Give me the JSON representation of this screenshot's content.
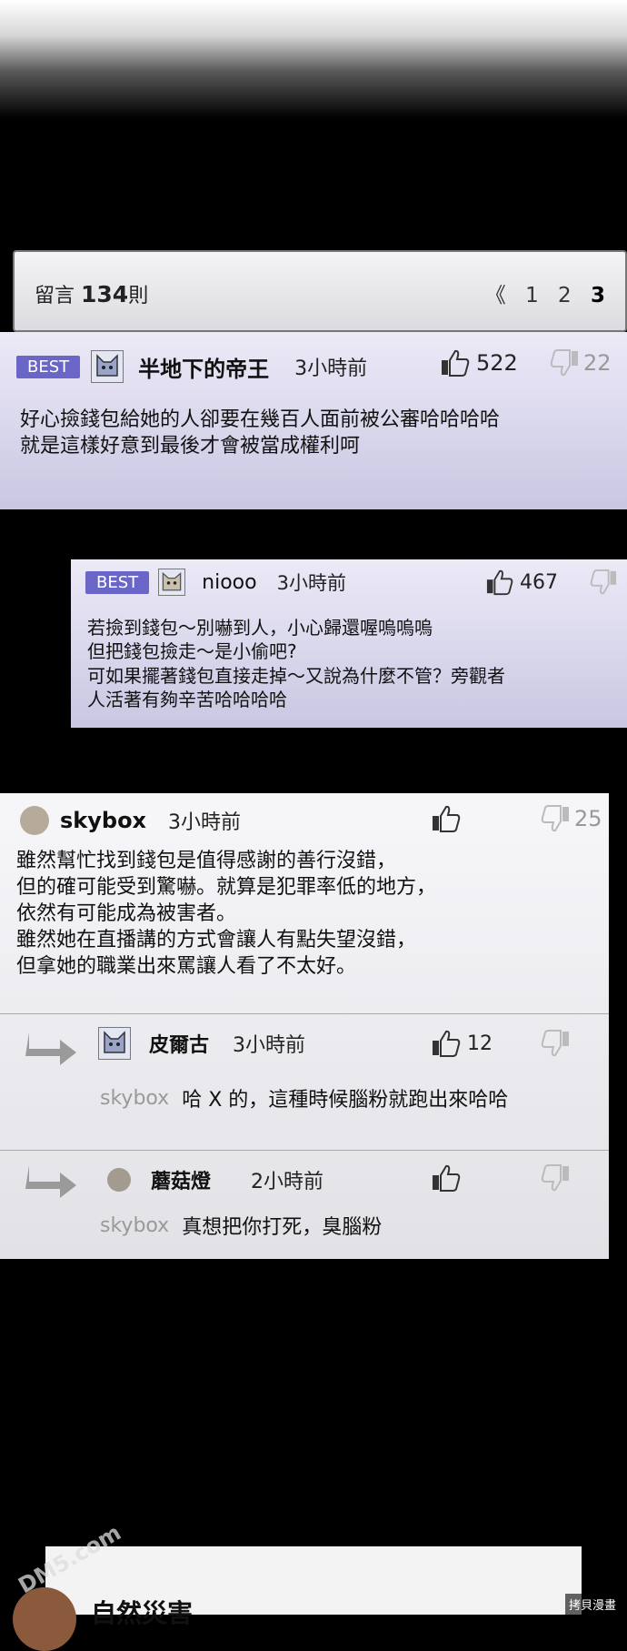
{
  "header": {
    "comment_count_prefix": "留言",
    "comment_count": "134",
    "comment_count_suffix": "則",
    "pager_prev": "《",
    "pages": [
      "1",
      "2",
      "3"
    ],
    "current_page": "3"
  },
  "comments": [
    {
      "badge": "BEST",
      "author": "半地下的帝王",
      "time": "3小時前",
      "likes": "522",
      "dislikes": "22",
      "text": "好心撿錢包給她的人卻要在幾百人面前被公審哈哈哈哈\n就是這樣好意到最後才會被當成權利呵"
    },
    {
      "badge": "BEST",
      "author": "niooo",
      "time": "3小時前",
      "likes": "467",
      "dislikes": "",
      "text": "若撿到錢包～別嚇到人，小心歸還喔嗚嗚嗚\n但把錢包撿走～是小偷吧?\n可如果擺著錢包直接走掉～又說為什麼不管？旁觀者\n人活著有夠辛苦哈哈哈哈"
    },
    {
      "badge": "",
      "author": "skybox",
      "time": "3小時前",
      "likes": "",
      "dislikes": "25",
      "text": "雖然幫忙找到錢包是值得感謝的善行沒錯，\n但的確可能受到驚嚇。就算是犯罪率低的地方，\n依然有可能成為被害者。\n雖然她在直播講的方式會讓人有點失望沒錯，\n但拿她的職業出來罵讓人看了不太好。",
      "replies": [
        {
          "author": "皮爾古",
          "time": "3小時前",
          "likes": "12",
          "reply_to": "skybox",
          "text": "哈 X 的，這種時候腦粉就跑出來哈哈"
        },
        {
          "author": "蘑菇燈",
          "time": "2小時前",
          "likes": "",
          "reply_to": "skybox",
          "text": "真想把你打死，臭腦粉"
        }
      ]
    }
  ],
  "next_panel": {
    "title": "自然災害"
  },
  "watermarks": {
    "left": "DM5.com",
    "right": "拷貝漫畫"
  },
  "colors": {
    "best_badge": "#6a66c8",
    "comment_bg": "#dcdaf0",
    "reply_to": "#999999"
  }
}
